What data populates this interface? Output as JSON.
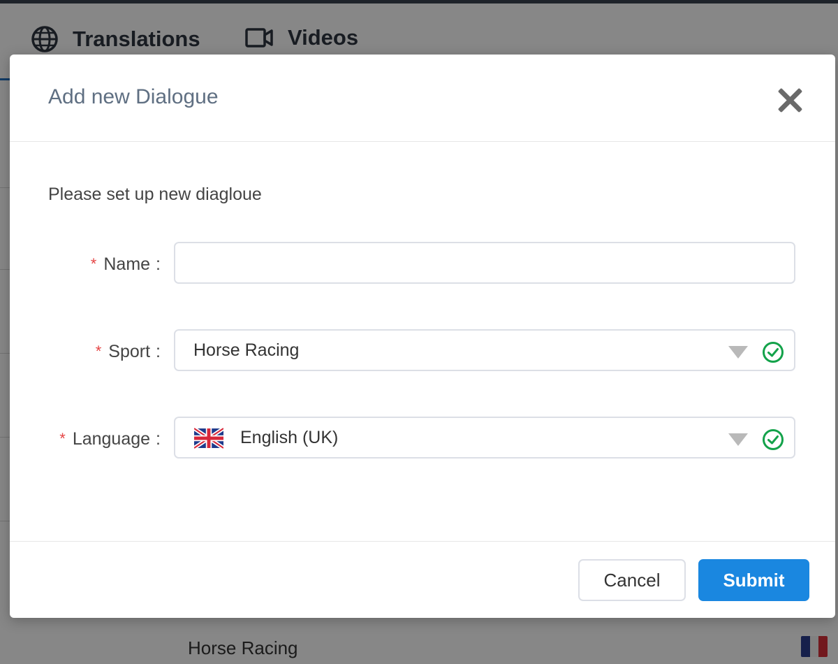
{
  "background": {
    "tabs": [
      {
        "label": "Translations",
        "icon": "globe-icon"
      },
      {
        "label": "Videos",
        "icon": "video-camera-icon"
      }
    ],
    "row_text": "Horse Racing",
    "row_flag": "france-flag-icon",
    "overlay_color": "#000000"
  },
  "modal": {
    "title": "Add new Dialogue",
    "close_icon": "close-icon",
    "intro": "Please set up new diagloue",
    "fields": {
      "name": {
        "label": "Name",
        "required_mark": "*",
        "value": "",
        "placeholder": ""
      },
      "sport": {
        "label": "Sport",
        "required_mark": "*",
        "value": "Horse Racing",
        "valid": true
      },
      "language": {
        "label": "Language",
        "required_mark": "*",
        "value": "English (UK)",
        "flag": "uk-flag-icon",
        "valid": true
      }
    },
    "buttons": {
      "cancel": "Cancel",
      "submit": "Submit"
    }
  },
  "colors": {
    "primary": "#1a87e0",
    "required": "#e54545",
    "success": "#13a24a",
    "title": "#5f6f82"
  }
}
